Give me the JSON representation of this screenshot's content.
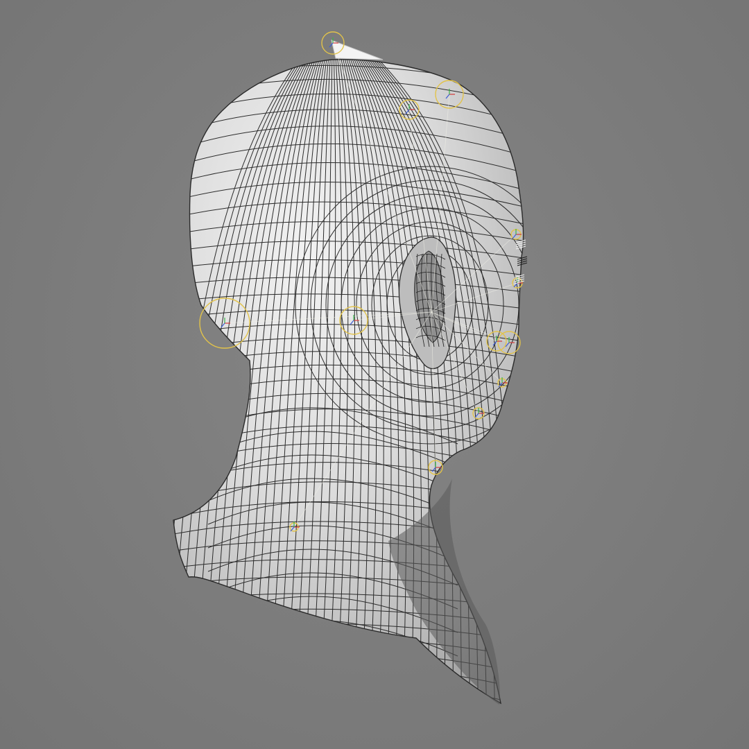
{
  "viewport": {
    "background_color": "#7c7c7c",
    "mesh_fill_color": "#d8d8d8",
    "wire_color": "#2a2a2a",
    "rig_control_color": "#e2c34a",
    "rig_line_color": "#f2f2e8",
    "axis_colors": {
      "x": "#d23b3b",
      "y": "#39b54a",
      "z": "#3b5bd6"
    },
    "object": "head-and-neck-mesh",
    "display_mode": "shaded-wireframe",
    "rig_controls_visible": true
  }
}
